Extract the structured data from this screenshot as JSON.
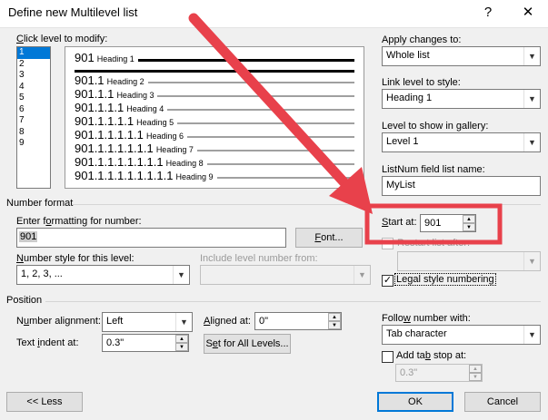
{
  "window": {
    "title": "Define new Multilevel list",
    "help": "?",
    "close": "✕"
  },
  "levels": {
    "label": "Click level to modify:",
    "items": [
      "1",
      "2",
      "3",
      "4",
      "5",
      "6",
      "7",
      "8",
      "9"
    ],
    "selected": "1"
  },
  "preview": {
    "rows": [
      {
        "num": "901",
        "heading": "Heading 1"
      },
      {
        "num": "901.1",
        "heading": "Heading 2"
      },
      {
        "num": "901.1.1",
        "heading": "Heading 3"
      },
      {
        "num": "901.1.1.1",
        "heading": "Heading 4"
      },
      {
        "num": "901.1.1.1.1",
        "heading": "Heading 5"
      },
      {
        "num": "901.1.1.1.1.1",
        "heading": "Heading 6"
      },
      {
        "num": "901.1.1.1.1.1.1",
        "heading": "Heading 7"
      },
      {
        "num": "901.1.1.1.1.1.1.1",
        "heading": "Heading 8"
      },
      {
        "num": "901.1.1.1.1.1.1.1.1",
        "heading": "Heading 9"
      }
    ]
  },
  "apply": {
    "label": "Apply changes to:",
    "value": "Whole list"
  },
  "link": {
    "label": "Link level to style:",
    "value": "Heading 1"
  },
  "gallery": {
    "label": "Level to show in gallery:",
    "value": "Level 1"
  },
  "listnum": {
    "label": "ListNum field list name:",
    "value": "MyList"
  },
  "number_format": {
    "section": "Number format",
    "enter_label": "Enter formatting for number:",
    "format_value": "901",
    "font_button": "Font...",
    "style_label": "Number style for this level:",
    "style_value": "1, 2, 3, ...",
    "include_label": "Include level number from:",
    "include_value": ""
  },
  "start_at": {
    "label": "Start at:",
    "value": "901"
  },
  "restart": {
    "label": "Restart list after:",
    "checked": false,
    "value": ""
  },
  "legal": {
    "label": "Legal style numbering",
    "checked": true
  },
  "position": {
    "section": "Position",
    "alignment_label": "Number alignment:",
    "alignment_value": "Left",
    "aligned_at_label": "Aligned at:",
    "aligned_at_value": "0\"",
    "indent_label": "Text indent at:",
    "indent_value": "0.3\"",
    "set_all_button": "Set for All Levels..."
  },
  "follow": {
    "label": "Follow number with:",
    "value": "Tab character"
  },
  "tabstop": {
    "label": "Add tab stop at:",
    "checked": false,
    "value": "0.3\""
  },
  "buttons": {
    "less": "<< Less",
    "ok": "OK",
    "cancel": "Cancel"
  },
  "annotation_color": "#e8414b"
}
